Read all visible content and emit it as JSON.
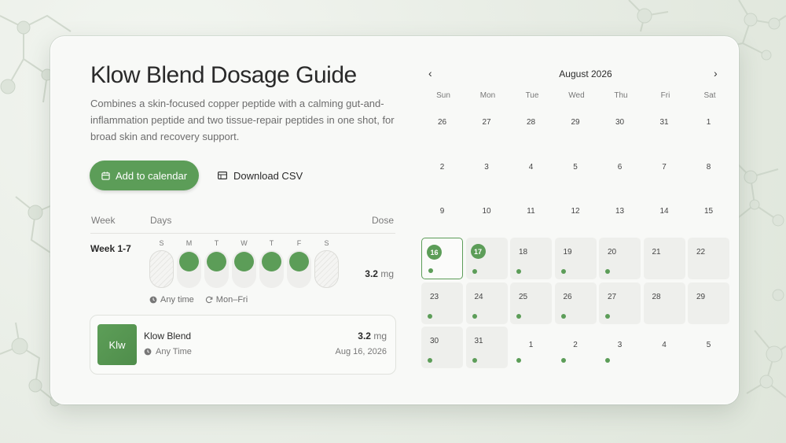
{
  "colors": {
    "accent": "#5c9d58",
    "card": "#f8f9f7"
  },
  "guide": {
    "title": "Klow Blend Dosage Guide",
    "description": "Combines a skin-focused copper peptide with a calming gut-and-inflammation peptide and two tissue-repair peptides in one shot, for broad skin and recovery support.",
    "add_to_calendar": "Add to calendar",
    "download_csv": "Download CSV"
  },
  "schedule": {
    "headers": {
      "week": "Week",
      "days": "Days",
      "dose": "Dose"
    },
    "rows": [
      {
        "week": "Week 1-7",
        "days": [
          {
            "letter": "S",
            "dosed": false
          },
          {
            "letter": "M",
            "dosed": true
          },
          {
            "letter": "T",
            "dosed": true
          },
          {
            "letter": "W",
            "dosed": true
          },
          {
            "letter": "T",
            "dosed": true
          },
          {
            "letter": "F",
            "dosed": true
          },
          {
            "letter": "S",
            "dosed": false
          }
        ],
        "dose_value": "3.2",
        "dose_unit": "mg",
        "time": "Any time",
        "frequency": "Mon–Fri"
      }
    ]
  },
  "summary": {
    "badge": "Klw",
    "name": "Klow Blend",
    "time": "Any Time",
    "dose_value": "3.2",
    "dose_unit": "mg",
    "date": "Aug 16, 2026"
  },
  "calendar": {
    "month_label": "August 2026",
    "prev_icon": "‹",
    "next_icon": "›",
    "weekdays": [
      "Sun",
      "Mon",
      "Tue",
      "Wed",
      "Thu",
      "Fri",
      "Sat"
    ],
    "days": [
      {
        "n": "26",
        "state": "plain"
      },
      {
        "n": "27",
        "state": "plain"
      },
      {
        "n": "28",
        "state": "plain"
      },
      {
        "n": "29",
        "state": "plain"
      },
      {
        "n": "30",
        "state": "plain"
      },
      {
        "n": "31",
        "state": "plain"
      },
      {
        "n": "1",
        "state": "plain"
      },
      {
        "n": "2",
        "state": "plain"
      },
      {
        "n": "3",
        "state": "plain"
      },
      {
        "n": "4",
        "state": "plain"
      },
      {
        "n": "5",
        "state": "plain"
      },
      {
        "n": "6",
        "state": "plain"
      },
      {
        "n": "7",
        "state": "plain"
      },
      {
        "n": "8",
        "state": "plain"
      },
      {
        "n": "9",
        "state": "plain"
      },
      {
        "n": "10",
        "state": "plain"
      },
      {
        "n": "11",
        "state": "plain"
      },
      {
        "n": "12",
        "state": "plain"
      },
      {
        "n": "13",
        "state": "plain"
      },
      {
        "n": "14",
        "state": "plain"
      },
      {
        "n": "15",
        "state": "plain"
      },
      {
        "n": "16",
        "state": "active",
        "today": true,
        "marked": true,
        "dose": true
      },
      {
        "n": "17",
        "state": "active",
        "marked": true,
        "dose": true
      },
      {
        "n": "18",
        "state": "active",
        "dose": true
      },
      {
        "n": "19",
        "state": "active",
        "dose": true
      },
      {
        "n": "20",
        "state": "active",
        "dose": true
      },
      {
        "n": "21",
        "state": "active"
      },
      {
        "n": "22",
        "state": "active"
      },
      {
        "n": "23",
        "state": "active",
        "dose": true
      },
      {
        "n": "24",
        "state": "active",
        "dose": true
      },
      {
        "n": "25",
        "state": "active",
        "dose": true
      },
      {
        "n": "26",
        "state": "active",
        "dose": true
      },
      {
        "n": "27",
        "state": "active",
        "dose": true
      },
      {
        "n": "28",
        "state": "active"
      },
      {
        "n": "29",
        "state": "active"
      },
      {
        "n": "30",
        "state": "active",
        "dose": true
      },
      {
        "n": "31",
        "state": "active",
        "dose": true
      },
      {
        "n": "1",
        "state": "plain",
        "dose": true
      },
      {
        "n": "2",
        "state": "plain",
        "dose": true
      },
      {
        "n": "3",
        "state": "plain",
        "dose": true
      },
      {
        "n": "4",
        "state": "plain"
      },
      {
        "n": "5",
        "state": "plain"
      }
    ]
  }
}
